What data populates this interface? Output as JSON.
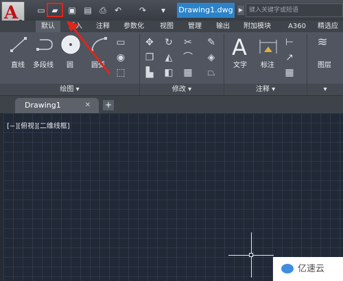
{
  "app": {
    "logo": "A"
  },
  "qat": {
    "items": [
      "new-icon",
      "open-icon",
      "save-icon",
      "saveas-icon",
      "plot-icon",
      "undo-icon",
      "redo-icon",
      "customize-icon"
    ]
  },
  "document": {
    "title": "Drawing1.dwg"
  },
  "search": {
    "placeholder": "键入关键字或短语"
  },
  "tabs": [
    "默认",
    "插入",
    "注释",
    "参数化",
    "视图",
    "管理",
    "输出",
    "附加模块",
    "A360",
    "精选应"
  ],
  "ribbon": {
    "draw": {
      "line": "直线",
      "polyline": "多段线",
      "circle": "圆",
      "arc": "圆弧",
      "footer": "绘图"
    },
    "modify": {
      "footer": "修改"
    },
    "annotation": {
      "text": "文字",
      "dimension": "标注",
      "footer": "注释"
    },
    "layer": {
      "label": "图层"
    }
  },
  "filetab": {
    "name": "Drawing1"
  },
  "viewport": {
    "label": "[−][俯视][二维线框]"
  },
  "watermark": {
    "text": "亿速云"
  },
  "colors": {
    "accent": "#2d83c9",
    "highlight": "#e0251b",
    "logo": "#c0101a"
  }
}
